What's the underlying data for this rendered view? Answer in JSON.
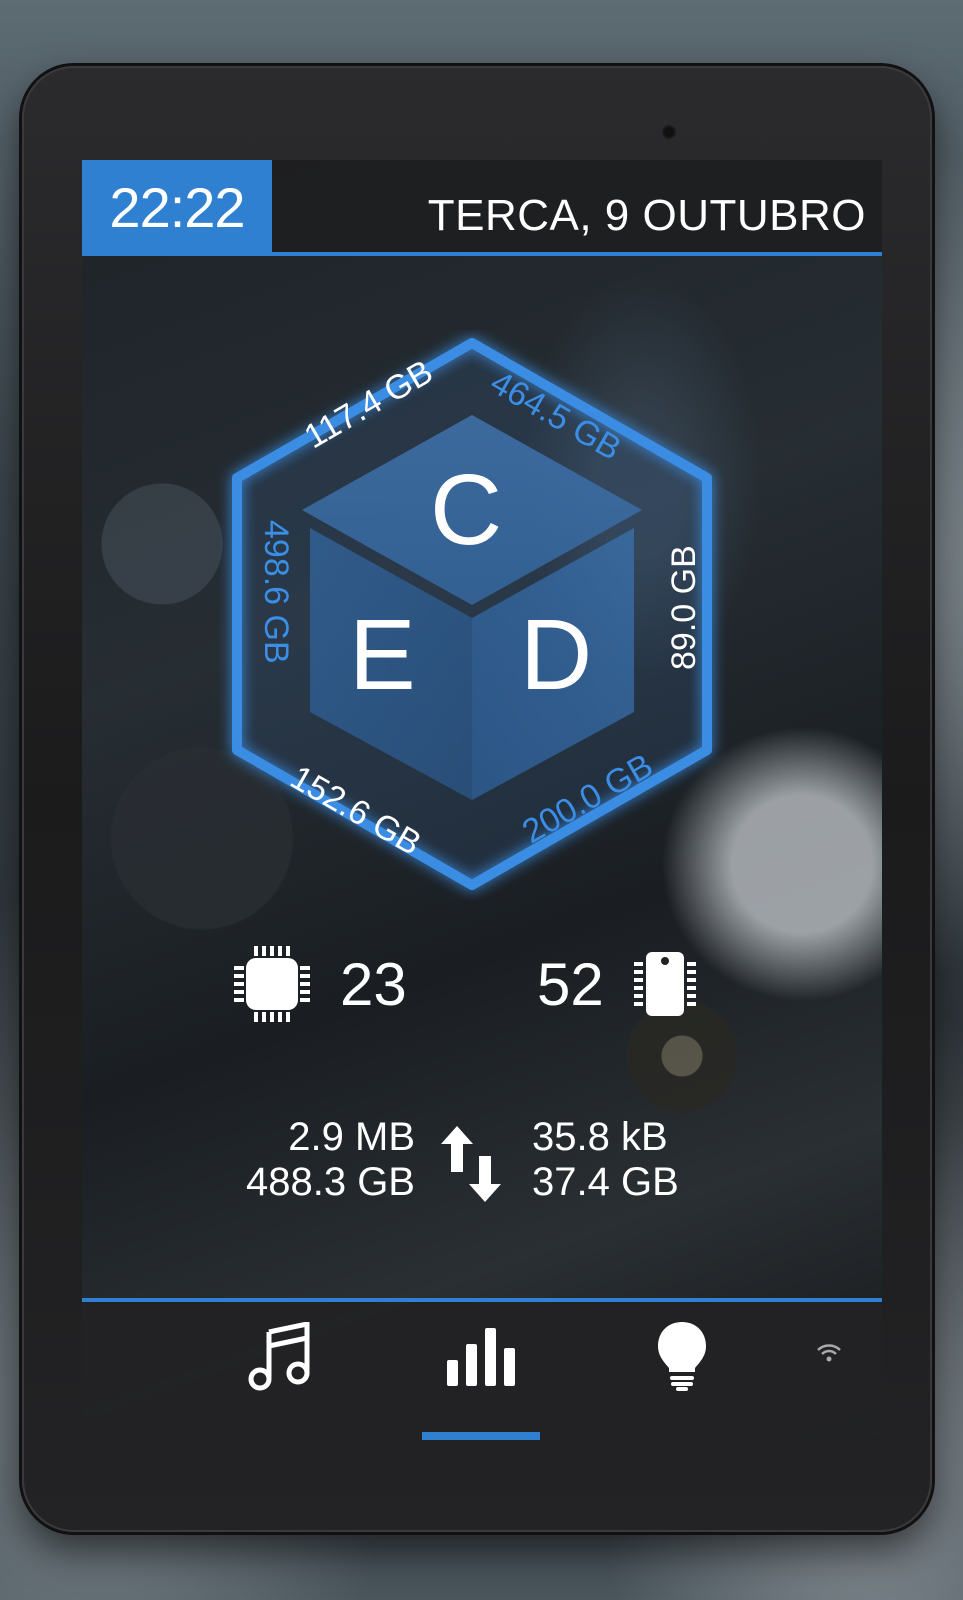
{
  "header": {
    "time": "22:22",
    "date": "TERCA, 9 OUTUBRO"
  },
  "drives": {
    "c": {
      "letter": "C",
      "used": "117.4 GB",
      "free": "464.5 GB"
    },
    "d": {
      "letter": "D",
      "used": "89.0 GB",
      "free": "200.0 GB"
    },
    "e": {
      "letter": "E",
      "used": "152.6 GB",
      "free": "498.6 GB"
    }
  },
  "stats": {
    "cpu": "23",
    "ram": "52",
    "cpu_icon": "cpu-chip-icon",
    "ram_icon": "memory-module-icon"
  },
  "network": {
    "upload_now": "2.9 MB",
    "upload_total": "488.3 GB",
    "download_now": "35.8 kB",
    "download_total": "37.4 GB",
    "transfer_icon": "up-down-arrows-icon"
  },
  "nav": {
    "tabs": [
      {
        "icon": "music-note-icon",
        "active": false
      },
      {
        "icon": "bar-chart-icon",
        "active": true
      },
      {
        "icon": "light-bulb-icon",
        "active": false
      }
    ],
    "status_icon": "wifi-icon"
  },
  "colors": {
    "accent": "#2f80d0",
    "text": "#ffffff"
  }
}
